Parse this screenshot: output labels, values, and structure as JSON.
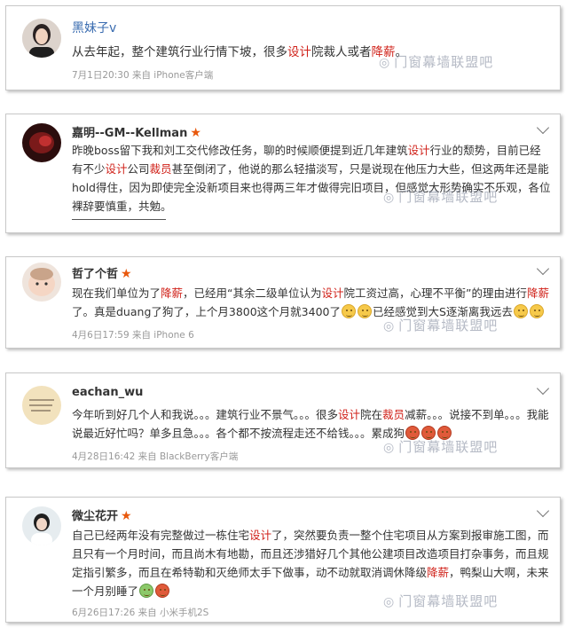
{
  "posts": [
    {
      "username": "黑妹子",
      "verified": "v",
      "text_segments": [
        {
          "t": "从去年起，整个建筑行业行情下坡，很多"
        },
        {
          "t": "设计",
          "hl": true
        },
        {
          "t": "院裁人或者"
        },
        {
          "t": "降薪",
          "hl": true
        },
        {
          "t": "。"
        }
      ],
      "meta": "7月1日20:30 来自 iPhone客户端"
    },
    {
      "username": "嘉明--GM--Kellman",
      "star": "★",
      "text_segments": [
        {
          "t": "昨晚boss留下我和刘工交代修改任务，聊的时候顺便提到近几年建筑"
        },
        {
          "t": "设计",
          "hl": true
        },
        {
          "t": "行业的颓势，目前已经有不少"
        },
        {
          "t": "设计",
          "hl": true
        },
        {
          "t": "公司"
        },
        {
          "t": "裁员",
          "hl": true
        },
        {
          "t": "甚至倒闭了，他说的那么轻描淡写，只是说现在他压力大些，但这两年还是能hold得住，因为即使完全没新项目来也得两三年才做得完旧项目，但感觉大形势确实不乐观，各位裸辞要慎重，共勉。"
        }
      ],
      "meta": ""
    },
    {
      "username": "哲了个哲",
      "star": "★",
      "text_segments": [
        {
          "t": "现在我们单位为了"
        },
        {
          "t": "降薪",
          "hl": true
        },
        {
          "t": "，已经用“其余二级单位认为"
        },
        {
          "t": "设计",
          "hl": true
        },
        {
          "t": "院工资过高，心理不平衡”的理由进行"
        },
        {
          "t": "降薪",
          "hl": true
        },
        {
          "t": "了。真是duang了狗了，上个月3800这个月就3400了"
        },
        {
          "emoji": "yellow"
        },
        {
          "emoji": "yellow"
        },
        {
          "t": "已经感觉到大S逐渐离我远去"
        },
        {
          "emoji": "yellow"
        },
        {
          "emoji": "yellow"
        }
      ],
      "meta": "4月6日17:59 来自 iPhone 6"
    },
    {
      "username": "eachan_wu",
      "text_segments": [
        {
          "t": "今年听到好几个人和我说。。。建筑行业不景气。。。很多"
        },
        {
          "t": "设计",
          "hl": true
        },
        {
          "t": "院在"
        },
        {
          "t": "裁员",
          "hl": true
        },
        {
          "t": "减薪。。。说接不到单。。。我能说最近好忙吗？单多且急。。。各个都不按流程走还不给钱。。。累成狗"
        },
        {
          "emoji": "red"
        },
        {
          "emoji": "red"
        },
        {
          "emoji": "red"
        }
      ],
      "meta": "4月28日16:42 来自 BlackBerry客户端"
    },
    {
      "username": "微尘花开",
      "star": "★",
      "text_segments": [
        {
          "t": "自己已经两年没有完整做过一栋住宅"
        },
        {
          "t": "设计",
          "hl": true
        },
        {
          "t": "了，突然要负责一整个住宅项目从方案到报审施工图，而且只有一个月时间，而且尚木有地勘，而且还涉猎好几个其他公建项目改造项目打杂事务，而且规定指引繁多，而且在希特勒和灭绝师太手下做事，动不动就取消调休降级"
        },
        {
          "t": "降薪",
          "hl": true
        },
        {
          "t": "，鸭梨山大啊，未来一个月别睡了"
        },
        {
          "emoji": "green"
        },
        {
          "emoji": "red"
        }
      ],
      "meta": "6月26日17:26 来自 小米手机2S"
    }
  ],
  "watermark": {
    "text": "门窗幕墙联盟吧",
    "icon": "wechat-icon"
  },
  "colors": {
    "highlight": "#d0221a",
    "username_verified": "#3a6cb0",
    "star": "#e8580c",
    "meta": "#999999"
  }
}
